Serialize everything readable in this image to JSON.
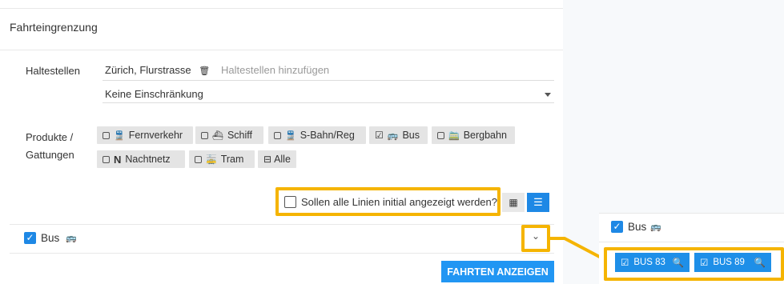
{
  "section": {
    "title": "Fahrteingrenzung"
  },
  "stops": {
    "label": "Haltestellen",
    "selected": "Zürich, Flurstrasse",
    "placeholder": "Haltestellen hinzufügen",
    "restriction_value": "Keine Einschränkung"
  },
  "products": {
    "label_line1": "Produkte /",
    "label_line2": "Gattungen",
    "items": [
      {
        "label": "Fernverkehr",
        "checked": false,
        "icon": "train-icon"
      },
      {
        "label": "Schiff",
        "checked": false,
        "icon": "ship-icon"
      },
      {
        "label": "S-Bahn/Reg",
        "checked": false,
        "icon": "regional-train-icon"
      },
      {
        "label": "Bus",
        "checked": true,
        "icon": "bus-icon"
      },
      {
        "label": "Bergbahn",
        "checked": false,
        "icon": "mountain-railway-icon"
      },
      {
        "label": "Nachtnetz",
        "checked": false,
        "icon": "night-n-icon",
        "icon_text": "N"
      },
      {
        "label": "Tram",
        "checked": false,
        "icon": "tram-icon"
      }
    ],
    "all_label": "Alle"
  },
  "options": {
    "show_all_lines_label": "Sollen alle Linien initial angezeigt werden?"
  },
  "bus_group": {
    "label": "Bus",
    "checked": true
  },
  "actions": {
    "show_trips_label": "FAHRTEN ANZEIGEN"
  },
  "zoom_panel": {
    "bus_label": "Bus",
    "lines": [
      {
        "label": "BUS 83"
      },
      {
        "label": "BUS 89"
      }
    ]
  },
  "colors": {
    "highlight": "#f5b400",
    "primary": "#2196f3",
    "chip_bg": "#e4e4e4"
  }
}
